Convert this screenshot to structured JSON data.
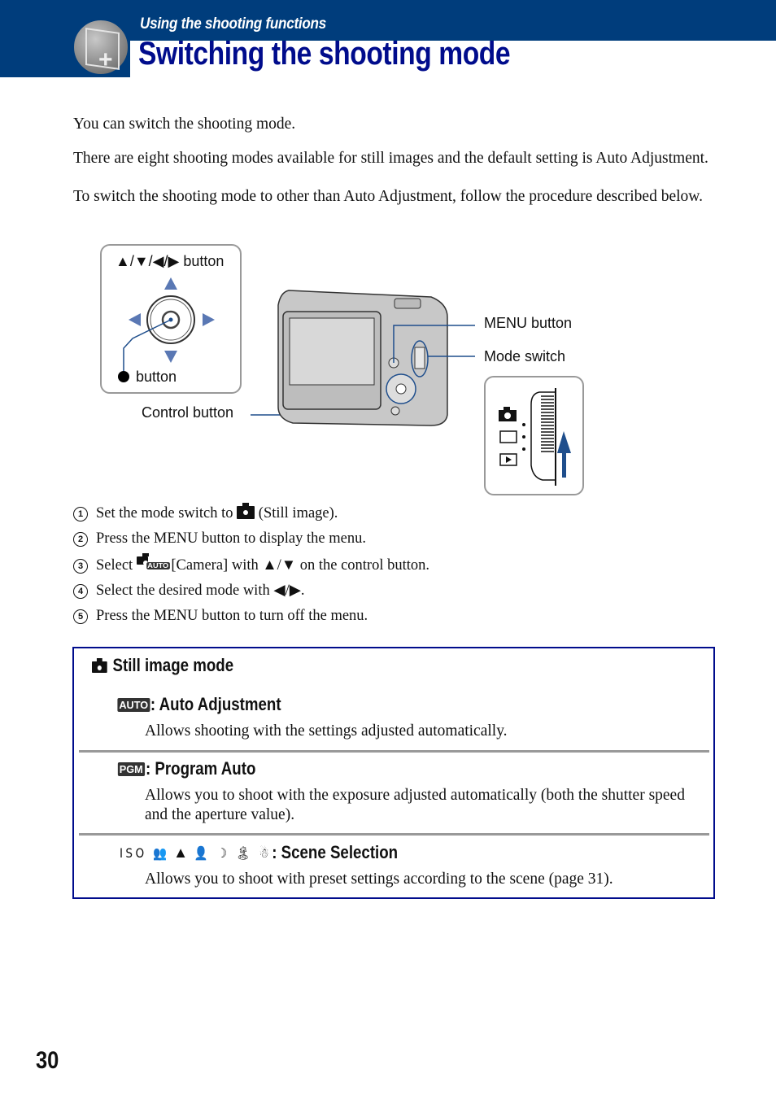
{
  "header": {
    "section": "Using the shooting functions",
    "title": "Switching the shooting mode",
    "logo_icon": "camera-plus-icon"
  },
  "intro": {
    "p1": "You can switch the shooting mode.",
    "p2": "There are eight shooting modes available for still images and the default setting is Auto Adjustment.",
    "p3": "To switch the shooting mode to other than Auto Adjustment, follow the procedure described below."
  },
  "diagram": {
    "arrows_button_label": "▲/▼/◀/▶ button",
    "center_button_label": "button",
    "control_button_label": "Control button",
    "menu_button_label": "MENU button",
    "mode_switch_label": "Mode switch",
    "mode_switch_positions": [
      "still-image",
      "movie",
      "playback"
    ],
    "accent_color": "#1f4e8c"
  },
  "steps": [
    {
      "num": "1",
      "pre": "Set the mode switch to",
      "icon": "camera-icon",
      "post": "(Still image)."
    },
    {
      "num": "2",
      "text": "Press the MENU button to display the menu."
    },
    {
      "num": "3",
      "pre": "Select",
      "icon": "camera-auto-icon",
      "post": "[Camera] with ▲/▼ on the control button."
    },
    {
      "num": "4",
      "text": "Select the desired mode with ◀/▶."
    },
    {
      "num": "5",
      "text": "Press the MENU button to turn off the menu."
    }
  ],
  "modes": {
    "heading": "Still image mode",
    "items": [
      {
        "badge": "AUTO",
        "title": ": Auto Adjustment",
        "desc": "Allows shooting with the settings adjusted automatically."
      },
      {
        "badge": "PGM",
        "title": ": Program Auto",
        "desc": "Allows you to shoot with the exposure adjusted automatically (both the shutter speed and the aperture value)."
      },
      {
        "icons": "ISO 👥 ⛰ 👤 ☽ 🏝 ☃",
        "title": ": Scene Selection",
        "desc": "Allows you to shoot with preset settings according to the scene (page 31)."
      }
    ]
  },
  "page_number": "30"
}
